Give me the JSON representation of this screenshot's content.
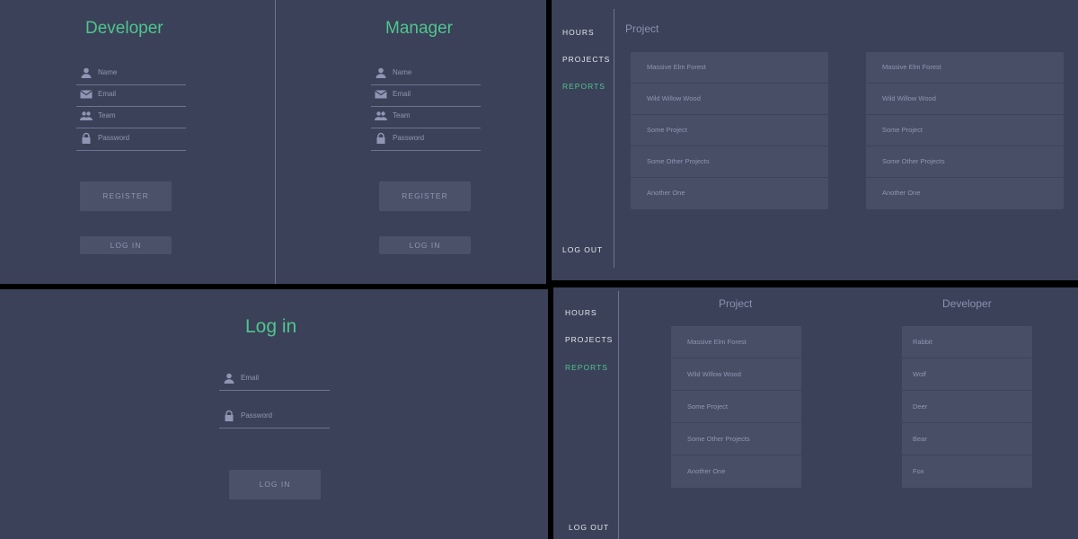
{
  "register": {
    "columns": [
      {
        "title": "Developer",
        "fields": [
          "Name",
          "Email",
          "Team",
          "Password"
        ],
        "register_label": "REGISTER",
        "login_label": "LOG IN"
      },
      {
        "title": "Manager",
        "fields": [
          "Name",
          "Email",
          "Team",
          "Password"
        ],
        "register_label": "REGISTER",
        "login_label": "LOG IN"
      }
    ]
  },
  "login": {
    "title": "Log in",
    "fields": [
      "Email",
      "Password"
    ],
    "button_label": "LOG IN"
  },
  "nav": {
    "items": [
      "HOURS",
      "PROJECTS",
      "REPORTS"
    ],
    "logout": "LOG OUT",
    "active": "REPORTS"
  },
  "reports_view_1": {
    "title": "Project",
    "left_list": [
      "Massive Elm Forest",
      "Wild Willow Wood",
      "Some Project",
      "Some Other Projects",
      "Another One"
    ],
    "right_list": [
      "Massive Elm Forest",
      "Wild Willow Wood",
      "Some Project",
      "Some Other Projects",
      "Another One"
    ]
  },
  "reports_view_2": {
    "project_title": "Project",
    "developer_title": "Developer",
    "projects": [
      "Massive Elm Forest",
      "Wild Willow Wood",
      "Some Project",
      "Some Other Projects",
      "Another One"
    ],
    "developers": [
      "Rabbit",
      "Wolf",
      "Deer",
      "Bear",
      "Fox"
    ]
  },
  "colors": {
    "background": "#3b4158",
    "accent": "#4fc58f",
    "card": "#474e66",
    "line": "#6d7491"
  }
}
